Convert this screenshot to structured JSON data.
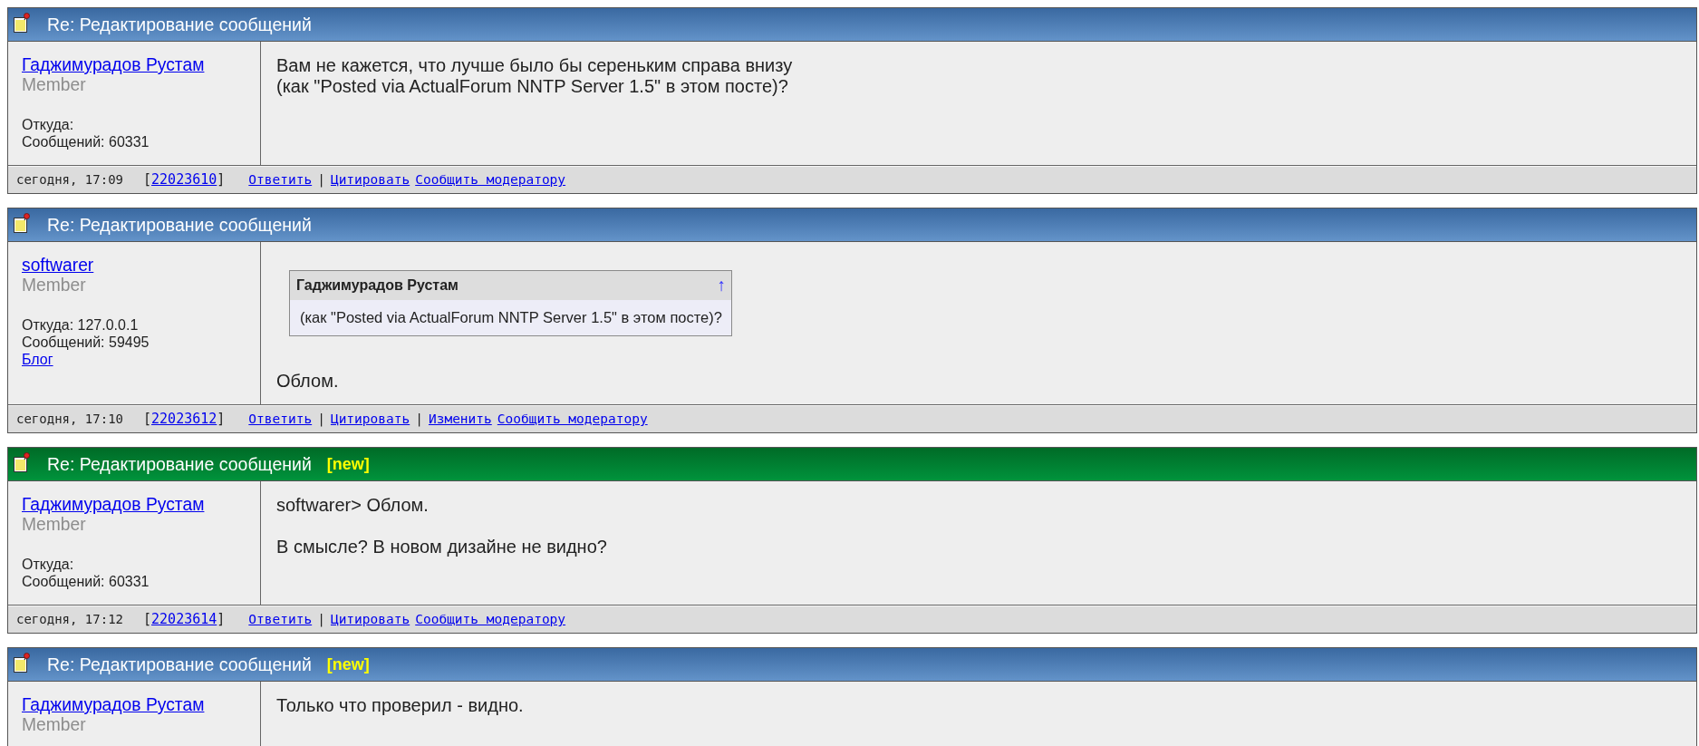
{
  "posts": [
    {
      "highlighted": false,
      "title": "Re: Редактирование сообщений",
      "author": {
        "name": "Гаджимурадов Рустам",
        "rank": "Member",
        "location": "Откуда:",
        "message_count": "Сообщений: 60331"
      },
      "message": [
        {
          "kind": "paragraph",
          "lines": [
            "Вам не кажется, что лучше было бы сереньким справа внизу",
            "(как \"Posted via ActualForum NNTP Server 1.5\" в этом посте)?"
          ]
        }
      ],
      "footer": {
        "date": "сегодня, 17:09",
        "number_open": "[",
        "number": "22023610",
        "number_close": "]",
        "actions": [
          {
            "kind": "link",
            "label": "Ответить"
          },
          {
            "kind": "separator",
            "label": "|"
          },
          {
            "kind": "link",
            "label": "Цитировать"
          },
          {
            "kind": "link",
            "label": "Сообщить модератору"
          }
        ]
      }
    },
    {
      "highlighted": false,
      "title": "Re: Редактирование сообщений",
      "author": {
        "name": "softwarer",
        "rank": "Member",
        "location": "Откуда: 127.0.0.1",
        "message_count": "Сообщений: 59495",
        "blog": "Блог"
      },
      "message": [
        {
          "kind": "quote",
          "author": "Гаджимурадов Рустам",
          "arrow": "↑",
          "text": "(как \"Posted via ActualForum NNTP Server 1.5\" в этом посте)?"
        },
        {
          "kind": "paragraph",
          "lines": [
            "Облом."
          ]
        }
      ],
      "footer": {
        "date": "сегодня, 17:10",
        "number_open": "[",
        "number": "22023612",
        "number_close": "]",
        "actions": [
          {
            "kind": "link",
            "label": "Ответить"
          },
          {
            "kind": "separator",
            "label": "|"
          },
          {
            "kind": "link",
            "label": "Цитировать"
          },
          {
            "kind": "separator",
            "label": "|"
          },
          {
            "kind": "link",
            "label": "Изменить"
          },
          {
            "kind": "link",
            "label": "Сообщить модератору"
          }
        ]
      }
    },
    {
      "highlighted": true,
      "title": "Re: Редактирование сообщений",
      "new_tag": "[new]",
      "author": {
        "name": "Гаджимурадов Рустам",
        "rank": "Member",
        "location": "Откуда:",
        "message_count": "Сообщений: 60331"
      },
      "message": [
        {
          "kind": "paragraph",
          "lines": [
            "softwarer> Облом."
          ]
        },
        {
          "kind": "paragraph",
          "lines": [
            "В смысле? В новом дизайне не видно?"
          ]
        }
      ],
      "footer": {
        "date": "сегодня, 17:12",
        "number_open": "[",
        "number": "22023614",
        "number_close": "]",
        "actions": [
          {
            "kind": "link",
            "label": "Ответить"
          },
          {
            "kind": "separator",
            "label": "|"
          },
          {
            "kind": "link",
            "label": "Цитировать"
          },
          {
            "kind": "link",
            "label": "Сообщить модератору"
          }
        ]
      }
    },
    {
      "highlighted": false,
      "title": "Re: Редактирование сообщений",
      "new_tag": "[new]",
      "author": {
        "name": "Гаджимурадов Рустам",
        "rank": "Member"
      },
      "message": [
        {
          "kind": "paragraph",
          "lines": [
            "Только что проверил - видно."
          ]
        }
      ]
    }
  ]
}
